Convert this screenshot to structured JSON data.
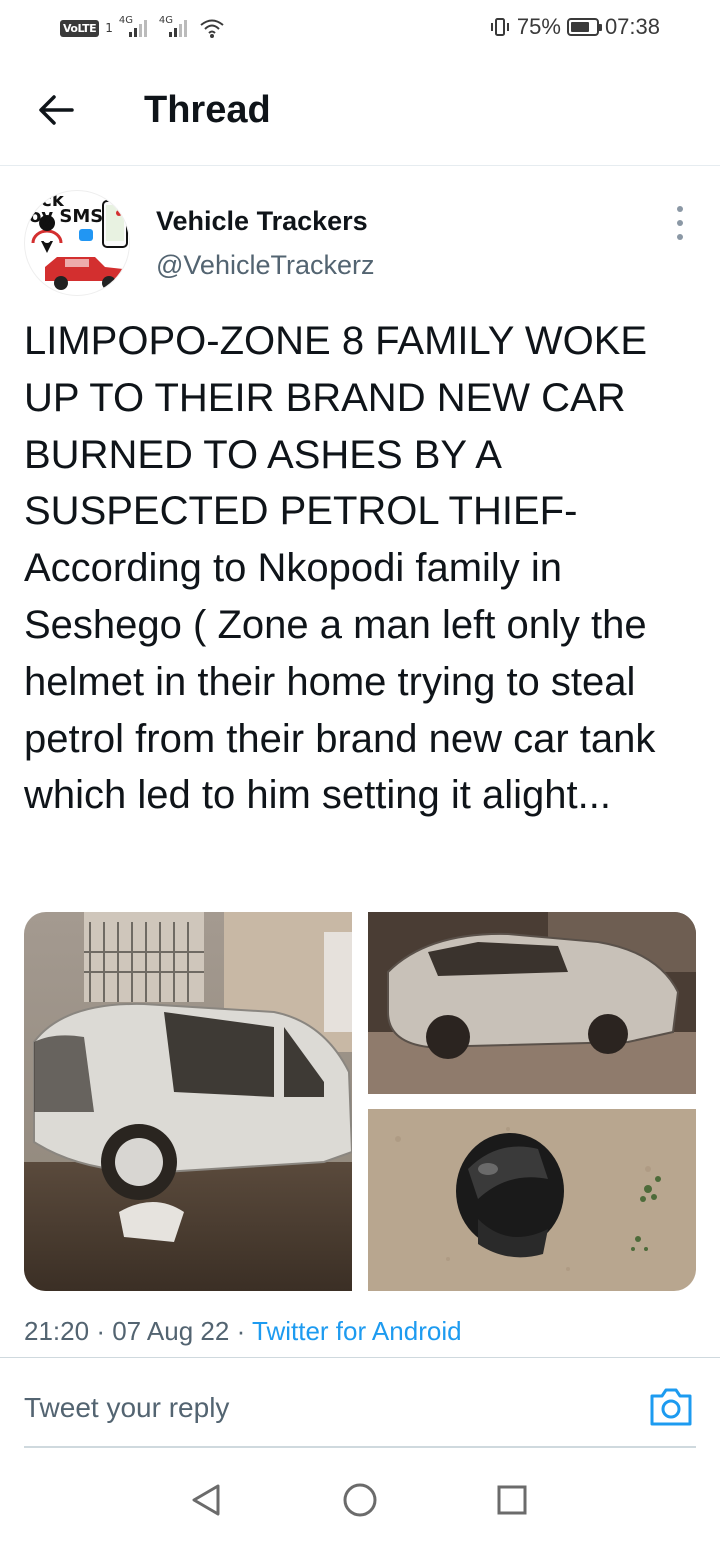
{
  "status_bar": {
    "volte": "VoLTE",
    "sim": "1",
    "network_1": "4G",
    "network_2": "4G",
    "battery_percent": "75%",
    "battery_level": 0.75,
    "time": "07:38",
    "icons": [
      "signal-icon",
      "wifi-icon",
      "vibrate-icon",
      "battery-icon"
    ]
  },
  "header": {
    "back_icon": "arrow-left-icon",
    "title": "Thread"
  },
  "tweet": {
    "avatar_text": "ack\noy SMS",
    "display_name": "Vehicle Trackers",
    "handle": "@VehicleTrackerz",
    "more_icon": "more-vertical-icon",
    "text": "LIMPOPO-ZONE 8 FAMILY WOKE UP TO THEIR BRAND NEW CAR BURNED TO ASHES BY A SUSPECTED PETROL THIEF-According to Nkopodi family in Seshego ( Zone a man left only the helmet in their home trying to steal petrol from their brand new car tank which led to him setting it alight...",
    "media": [
      "burned-car-photo",
      "burned-car-night-photo",
      "helmet-photo"
    ],
    "time": "21:20",
    "date": "07 Aug 22",
    "sep": "·",
    "source": "Twitter for Android"
  },
  "reply": {
    "placeholder": "Tweet your reply",
    "camera_icon": "camera-icon"
  },
  "nav": {
    "back_icon": "nav-back-icon",
    "home_icon": "nav-home-icon",
    "recents_icon": "nav-recents-icon"
  },
  "colors": {
    "text": "#0f1419",
    "secondary": "#536471",
    "link": "#1d9bf0",
    "divider": "#cfd9de"
  }
}
